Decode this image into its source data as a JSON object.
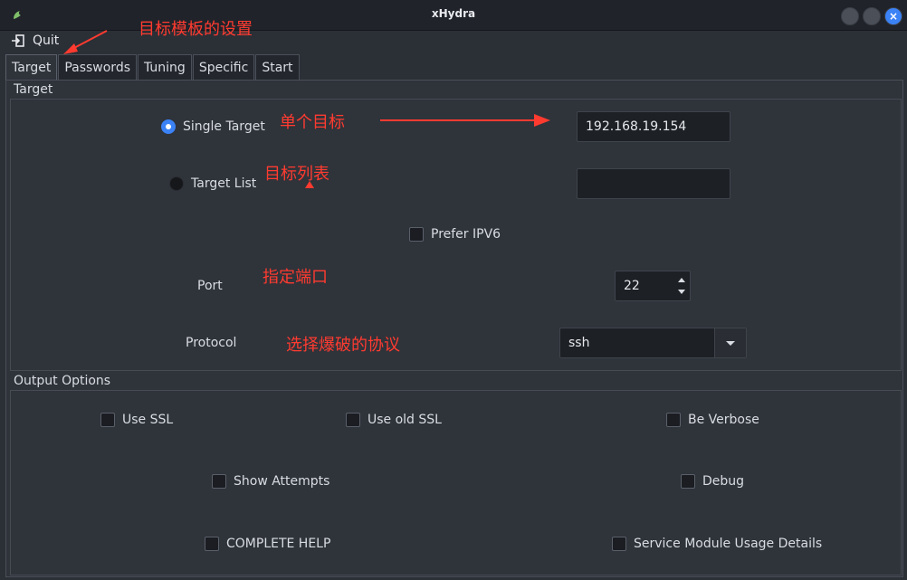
{
  "window": {
    "title": "xHydra"
  },
  "toolbar": {
    "quit_label": "Quit"
  },
  "tabs": [
    {
      "label": "Target"
    },
    {
      "label": "Passwords"
    },
    {
      "label": "Tuning"
    },
    {
      "label": "Specific"
    },
    {
      "label": "Start"
    }
  ],
  "target_group": {
    "title": "Target",
    "single_target_label": "Single Target",
    "single_target_value": "192.168.19.154",
    "target_list_label": "Target List",
    "target_list_value": "",
    "prefer_ipv6_label": "Prefer IPV6",
    "port_label": "Port",
    "port_value": "22",
    "protocol_label": "Protocol",
    "protocol_value": "ssh"
  },
  "output_group": {
    "title": "Output Options",
    "use_ssl": "Use SSL",
    "use_old_ssl": "Use old SSL",
    "be_verbose": "Be Verbose",
    "show_attempts": "Show Attempts",
    "debug": "Debug",
    "complete_help": "COMPLETE HELP",
    "service_module": "Service Module Usage Details"
  },
  "annotations": {
    "template_settings": "目标模板的设置",
    "single_target": "单个目标",
    "target_list": "目标列表",
    "port": "指定端口",
    "protocol": "选择爆破的协议"
  },
  "colors": {
    "accent": "#3b82f6",
    "annotation": "#ff3b30"
  }
}
